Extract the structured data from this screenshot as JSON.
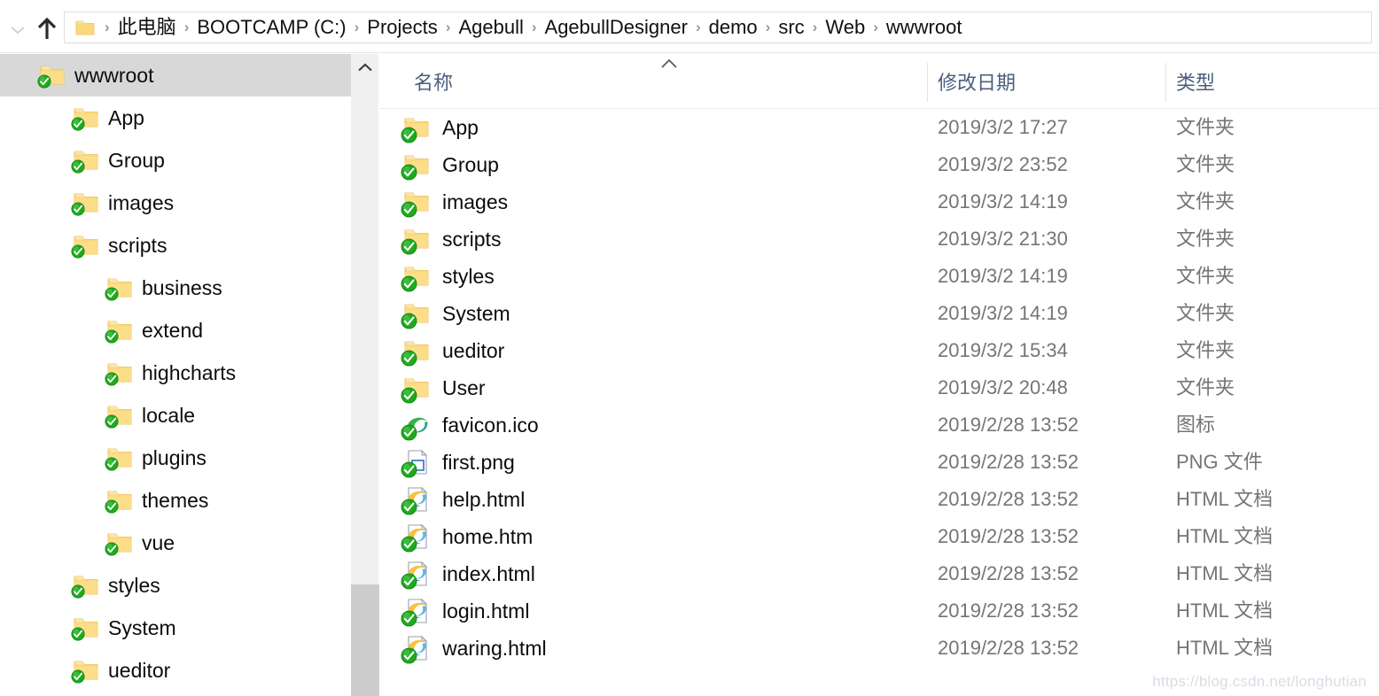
{
  "address_bar": {
    "recent_locations_icon": "chevron-down-icon",
    "up_icon": "arrow-up-icon",
    "folder_icon": "folder-icon",
    "separator": "›",
    "breadcrumbs": [
      "此电脑",
      "BOOTCAMP (C:)",
      "Projects",
      "Agebull",
      "AgebullDesigner",
      "demo",
      "src",
      "Web",
      "wwwroot"
    ]
  },
  "sidebar": {
    "scroll_up_icon": "chevron-up-icon",
    "items": [
      {
        "label": "wwwroot",
        "indent": 0,
        "selected": true,
        "icon": "folder-synced-icon"
      },
      {
        "label": "App",
        "indent": 1,
        "selected": false,
        "icon": "folder-synced-icon"
      },
      {
        "label": "Group",
        "indent": 1,
        "selected": false,
        "icon": "folder-synced-icon"
      },
      {
        "label": "images",
        "indent": 1,
        "selected": false,
        "icon": "folder-synced-icon"
      },
      {
        "label": "scripts",
        "indent": 1,
        "selected": false,
        "icon": "folder-synced-icon"
      },
      {
        "label": "business",
        "indent": 2,
        "selected": false,
        "icon": "folder-synced-icon"
      },
      {
        "label": "extend",
        "indent": 2,
        "selected": false,
        "icon": "folder-synced-icon"
      },
      {
        "label": "highcharts",
        "indent": 2,
        "selected": false,
        "icon": "folder-synced-icon"
      },
      {
        "label": "locale",
        "indent": 2,
        "selected": false,
        "icon": "folder-synced-icon"
      },
      {
        "label": "plugins",
        "indent": 2,
        "selected": false,
        "icon": "folder-synced-icon"
      },
      {
        "label": "themes",
        "indent": 2,
        "selected": false,
        "icon": "folder-synced-icon"
      },
      {
        "label": "vue",
        "indent": 2,
        "selected": false,
        "icon": "folder-synced-icon"
      },
      {
        "label": "styles",
        "indent": 1,
        "selected": false,
        "icon": "folder-synced-icon"
      },
      {
        "label": "System",
        "indent": 1,
        "selected": false,
        "icon": "folder-synced-icon"
      },
      {
        "label": "ueditor",
        "indent": 1,
        "selected": false,
        "icon": "folder-synced-icon"
      }
    ]
  },
  "file_list": {
    "columns": [
      {
        "key": "name",
        "label": "名称",
        "sorted": "asc"
      },
      {
        "key": "date",
        "label": "修改日期",
        "sorted": ""
      },
      {
        "key": "type",
        "label": "类型",
        "sorted": ""
      }
    ],
    "sort_icon": "chevron-up-icon",
    "rows": [
      {
        "name": "App",
        "date": "2019/3/2 17:27",
        "type": "文件夹",
        "icon": "folder-synced-icon"
      },
      {
        "name": "Group",
        "date": "2019/3/2 23:52",
        "type": "文件夹",
        "icon": "folder-synced-icon"
      },
      {
        "name": "images",
        "date": "2019/3/2 14:19",
        "type": "文件夹",
        "icon": "folder-synced-icon"
      },
      {
        "name": "scripts",
        "date": "2019/3/2 21:30",
        "type": "文件夹",
        "icon": "folder-synced-icon"
      },
      {
        "name": "styles",
        "date": "2019/3/2 14:19",
        "type": "文件夹",
        "icon": "folder-synced-icon"
      },
      {
        "name": "System",
        "date": "2019/3/2 14:19",
        "type": "文件夹",
        "icon": "folder-synced-icon"
      },
      {
        "name": "ueditor",
        "date": "2019/3/2 15:34",
        "type": "文件夹",
        "icon": "folder-synced-icon"
      },
      {
        "name": "User",
        "date": "2019/3/2 20:48",
        "type": "文件夹",
        "icon": "folder-synced-icon"
      },
      {
        "name": "favicon.ico",
        "date": "2019/2/28 13:52",
        "type": "图标",
        "icon": "browser-favicon-icon"
      },
      {
        "name": "first.png",
        "date": "2019/2/28 13:52",
        "type": "PNG 文件",
        "icon": "png-image-icon"
      },
      {
        "name": "help.html",
        "date": "2019/2/28 13:52",
        "type": "HTML 文档",
        "icon": "html-document-icon"
      },
      {
        "name": "home.htm",
        "date": "2019/2/28 13:52",
        "type": "HTML 文档",
        "icon": "html-document-icon"
      },
      {
        "name": "index.html",
        "date": "2019/2/28 13:52",
        "type": "HTML 文档",
        "icon": "html-document-icon"
      },
      {
        "name": "login.html",
        "date": "2019/2/28 13:52",
        "type": "HTML 文档",
        "icon": "html-document-icon"
      },
      {
        "name": "waring.html",
        "date": "2019/2/28 13:52",
        "type": "HTML 文档",
        "icon": "html-document-icon"
      }
    ]
  },
  "watermark": {
    "text": "https://blog.csdn.net/longhutian"
  },
  "colors": {
    "folder_yellow": "#fbd97a",
    "folder_yellow_dark": "#f0c24a",
    "sync_green": "#1eaa1e",
    "header_blue_gray": "#4a5f7f",
    "selection_gray": "#d8d8d8",
    "scrollbar_thumb": "#cdcdcd",
    "scrollbar_track": "#f0f0f0",
    "secondary_text": "#757575"
  }
}
